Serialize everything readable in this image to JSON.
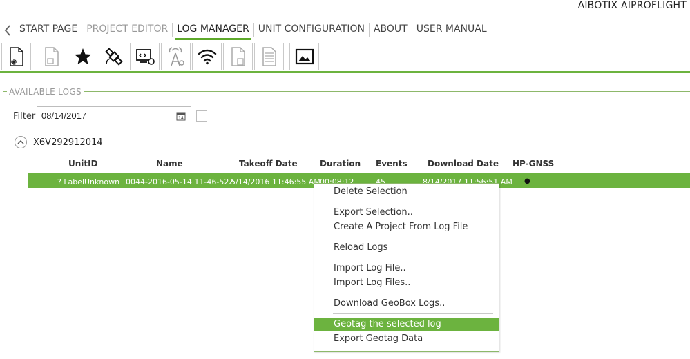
{
  "app_title": "AIBOTIX AIPROFLIGHT",
  "nav": {
    "start": "START PAGE",
    "project": "PROJECT EDITOR",
    "log": "LOG MANAGER",
    "unit": "UNIT CONFIGURATION",
    "about": "ABOUT",
    "manual": "USER MANUAL"
  },
  "toolbar": [
    "new-log-icon",
    "save-log-icon",
    "star-icon",
    "satellite-icon",
    "device-settings-icon",
    "antenna-settings-icon",
    "wifi-icon",
    "delete-file-icon",
    "document-icon",
    "image-icon"
  ],
  "section": {
    "legend": "AVAILABLE LOGS"
  },
  "filter": {
    "label": "Filter",
    "value": "08/14/2017",
    "calendar_day": "14"
  },
  "group": {
    "label": "X6V292912014"
  },
  "table": {
    "headers": {
      "unit_id": "UnitID",
      "name": "Name",
      "takeoff": "Takeoff Date",
      "duration": "Duration",
      "events": "Events",
      "download": "Download Date",
      "hp_gnss": "HP-GNSS"
    },
    "row": {
      "unit_id": "? LabelUnknown",
      "name": "0044-2016-05-14 11-46-52Z",
      "takeoff": "5/14/2016 11:46:55 AM",
      "duration": "00:08:12",
      "events": "45",
      "download": "8/14/2017 11:56:51 AM",
      "hp_gnss": "●"
    }
  },
  "context_menu": {
    "delete": "Delete Selection",
    "export": "Export Selection..",
    "create_project": "Create A Project From Log File",
    "reload": "Reload Logs",
    "import_file": "Import Log File..",
    "import_files": "Import Log Files..",
    "geobox": "Download GeoBox Logs..",
    "geotag": "Geotag the selected log",
    "export_geotag": "Export Geotag Data"
  },
  "colors": {
    "accent": "#6cb33f",
    "border": "#8db86a"
  }
}
